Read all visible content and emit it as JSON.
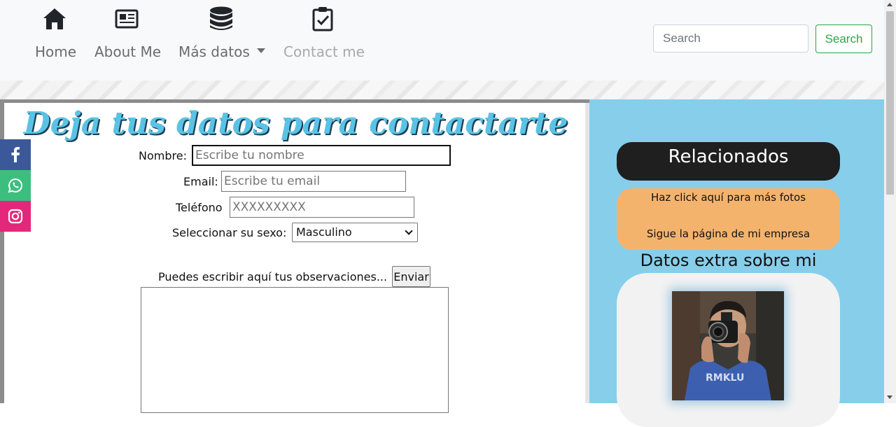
{
  "nav": {
    "items": [
      {
        "label": "Home",
        "icon": "home-icon"
      },
      {
        "label": "About Me",
        "icon": "newspaper-icon"
      },
      {
        "label": "Más datos",
        "icon": "database-icon"
      },
      {
        "label": "Contact me",
        "icon": "clipboard-check-icon"
      }
    ],
    "search_placeholder": "Search",
    "search_button": "Search"
  },
  "form": {
    "title": "Deja tus datos para contactarte",
    "nombre_label": "Nombre:",
    "nombre_placeholder": "Escribe tu nombre",
    "email_label": "Email:",
    "email_placeholder": "Escribe tu email",
    "telefono_label": "Teléfono",
    "telefono_placeholder": "XXXXXXXXX",
    "sexo_label": "Seleccionar su sexo:",
    "sexo_value": "Masculino",
    "observaciones_label": "Puedes escribir aquí tus observaciones...",
    "submit_label": "Enviar"
  },
  "social": [
    {
      "name": "facebook",
      "icon": "facebook-icon",
      "color": "#3b5998"
    },
    {
      "name": "whatsapp",
      "icon": "whatsapp-icon",
      "color": "#3cbf7e"
    },
    {
      "name": "instagram",
      "icon": "instagram-icon",
      "color": "#e4277b"
    }
  ],
  "aside": {
    "related_title": "Relacionados",
    "link_photos": "Haz click aquí para más fotos",
    "link_company": "Sigue la página de mi empresa",
    "extra_title": "Datos extra sobre mi"
  },
  "colors": {
    "aside_bg": "#87ceeb",
    "title_color": "#5ac3e5",
    "links_box": "#f4b36d",
    "search_green": "#28a745"
  }
}
